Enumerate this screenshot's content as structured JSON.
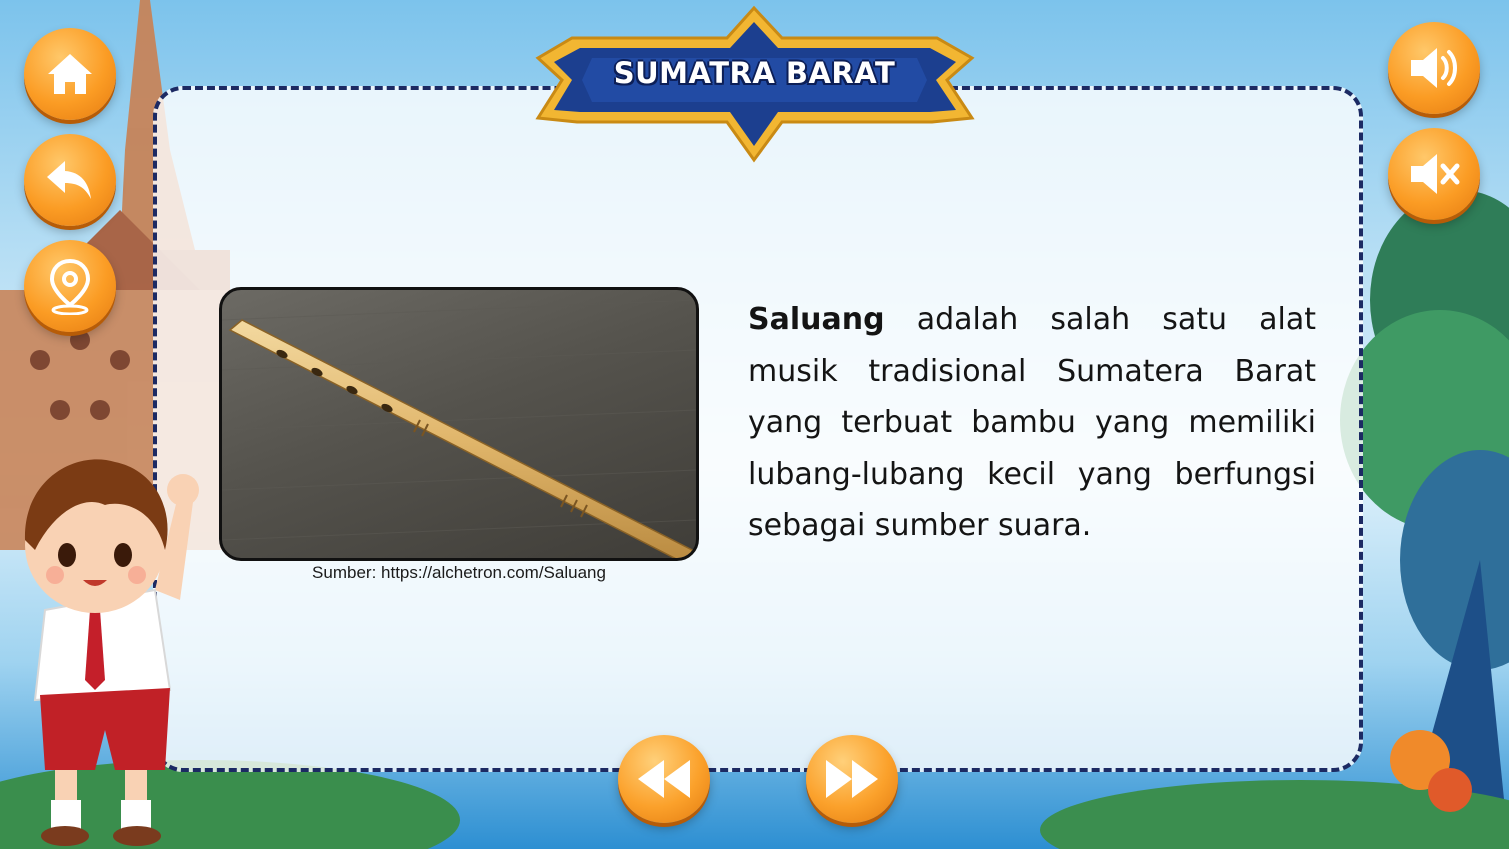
{
  "header": {
    "title": "SUMATRA BARAT"
  },
  "left_menu": {
    "home": {
      "icon": "home-icon"
    },
    "back": {
      "icon": "back-arrow-icon"
    },
    "map": {
      "icon": "map-pin-icon"
    }
  },
  "right_menu": {
    "sound_on": {
      "icon": "speaker-on-icon"
    },
    "sound_off": {
      "icon": "speaker-mute-icon"
    }
  },
  "content": {
    "image_caption": "Sumber: https://alchetron.com/Saluang",
    "term": "Saluang",
    "description": " adalah salah satu alat musik tradisional Sumatera Barat yang terbuat bambu yang memiliki lubang-lubang kecil yang berfungsi sebagai sumber suara."
  },
  "navigation": {
    "prev": {
      "icon": "rewind-icon"
    },
    "next": {
      "icon": "fast-forward-icon"
    }
  },
  "colors": {
    "button_orange": "#fb9c24",
    "banner_navy": "#1c3f8f",
    "banner_gold": "#f2b632",
    "card_border": "#1c2a63"
  }
}
